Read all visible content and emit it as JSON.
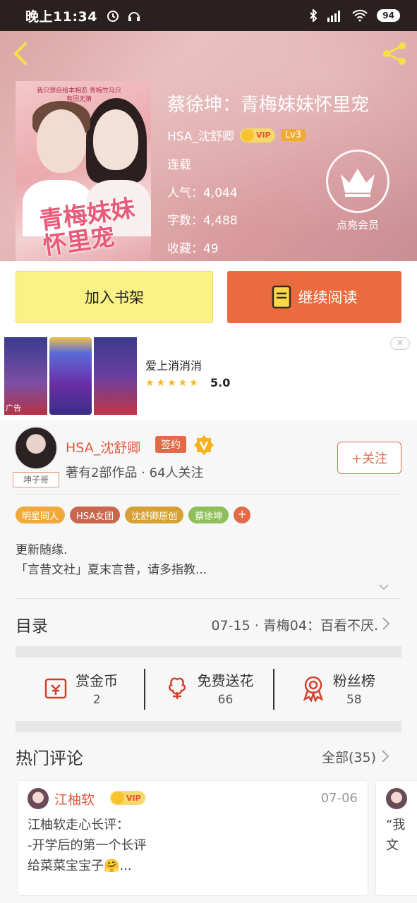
{
  "status_bar": {
    "time": "晚上11:34",
    "battery": "94"
  },
  "book": {
    "title": "蔡徐坤：青梅妹妹怀里宠",
    "author": "HSA_沈舒卿",
    "vip_label": "VIP",
    "level": "Lv3",
    "status": "连载",
    "popularity": "人气：4,044",
    "word_count": "字数：4,488",
    "favorites": "收藏：49",
    "cover_title": "青梅妹妹怀里宠",
    "cover_tagline": "我只想自给本相恋 青梅竹马只有回无猜"
  },
  "member": {
    "label": "点亮会员"
  },
  "actions": {
    "add_shelf": "加入书架",
    "continue_reading": "继续阅读"
  },
  "ad": {
    "name": "爱上消消消",
    "rating": "5.0",
    "badge": "广告",
    "stars": 5
  },
  "author_card": {
    "name": "HSA_沈舒卿",
    "signed_badge": "签约",
    "avatar_tag": "坤子哥",
    "stats": "著有2部作品 · 64人关注",
    "follow": "+关注"
  },
  "tags": [
    {
      "label": "明星同人",
      "color": "#f2a93b"
    },
    {
      "label": "HSA女团",
      "color": "#c9674e"
    },
    {
      "label": "沈舒卿原创",
      "color": "#d6a033"
    },
    {
      "label": "蔡徐坤",
      "color": "#8fbf58"
    }
  ],
  "intro": {
    "line1": "更新随缘.",
    "line2": "「言昔文社」夏末言昔，请多指教..."
  },
  "catalog": {
    "label": "目录",
    "latest": "07-15 · 青梅04：百看不厌."
  },
  "rewards": [
    {
      "label": "赏金币",
      "value": "2",
      "icon": "coin-bag-icon"
    },
    {
      "label": "免费送花",
      "value": "66",
      "icon": "flower-icon"
    },
    {
      "label": "粉丝榜",
      "value": "58",
      "icon": "medal-icon"
    }
  ],
  "hot_comments": {
    "label": "热门评论",
    "all": "全部(35)",
    "items": [
      {
        "user": "江柚软",
        "vip": "VIP",
        "date": "07-06",
        "lines": [
          "江柚软走心长评：",
          "-开学后的第一个长评",
          "给菜菜宝宝子🤗..."
        ]
      },
      {
        "lines": [
          "“我",
          "文"
        ]
      }
    ]
  },
  "colors": {
    "accent_orange": "#ea6b3e",
    "shelf_yellow": "#fbf285",
    "name_red": "#e15a3c"
  }
}
